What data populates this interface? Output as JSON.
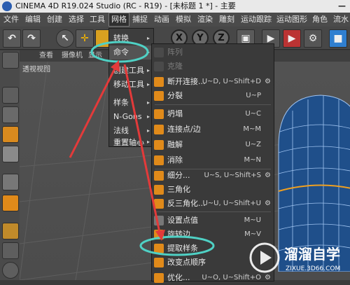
{
  "app": {
    "title": "CINEMA 4D R19.024 Studio (RC - R19) - [未标题 1 *] - 主要",
    "minimize": "—"
  },
  "menubar": [
    "文件",
    "编辑",
    "创建",
    "选择",
    "工具",
    "网格",
    "捕捉",
    "动画",
    "模拟",
    "渲染",
    "雕刻",
    "运动跟踪",
    "运动图形",
    "角色",
    "流水"
  ],
  "toolbar": {
    "axes": [
      "X",
      "Y",
      "Z"
    ]
  },
  "viewbar": [
    "查看",
    "摄像机",
    "显示"
  ],
  "viewport": {
    "label": "透视视图"
  },
  "submenu1": [
    {
      "label": "转换",
      "arrow": "▸"
    },
    {
      "label": "命令",
      "arrow": "▸"
    },
    {
      "label": "创建工具",
      "arrow": "▸"
    },
    {
      "label": "移动工具",
      "arrow": "▸"
    },
    {
      "label": "样条",
      "arrow": "▸"
    },
    {
      "label": "N-Gons",
      "arrow": "▸"
    },
    {
      "label": "法线",
      "arrow": "▸"
    },
    {
      "label": "重置轴心",
      "arrow": "▸"
    }
  ],
  "submenu2": [
    {
      "label": "阵列",
      "shortcut": "",
      "disabled": true,
      "gear": ""
    },
    {
      "label": "克隆",
      "shortcut": "",
      "disabled": true,
      "gear": ""
    },
    {
      "label": "断开连接...",
      "shortcut": "U~D, U~Shift+D",
      "disabled": false,
      "gear": "⚙"
    },
    {
      "label": "分裂",
      "shortcut": "U~P",
      "disabled": false,
      "gear": ""
    },
    {
      "label": "坍塌",
      "shortcut": "U~C",
      "disabled": false,
      "gear": ""
    },
    {
      "label": "连接点/边",
      "shortcut": "M~M",
      "disabled": false,
      "gear": ""
    },
    {
      "label": "融解",
      "shortcut": "U~Z",
      "disabled": false,
      "gear": ""
    },
    {
      "label": "消除",
      "shortcut": "M~N",
      "disabled": false,
      "gear": ""
    },
    {
      "label": "细分...",
      "shortcut": "U~S, U~Shift+S",
      "disabled": false,
      "gear": "⚙"
    },
    {
      "label": "三角化",
      "shortcut": "",
      "disabled": false,
      "gear": ""
    },
    {
      "label": "反三角化...",
      "shortcut": "U~U, U~Shift+U",
      "disabled": false,
      "gear": "⚙"
    },
    {
      "label": "设置点值",
      "shortcut": "M~U",
      "disabled": false,
      "gear": ""
    },
    {
      "label": "旋转边",
      "shortcut": "M~V",
      "disabled": false,
      "gear": ""
    },
    {
      "label": "提取样条",
      "shortcut": "",
      "disabled": false,
      "gear": ""
    },
    {
      "label": "改变点顺序",
      "shortcut": "",
      "disabled": false,
      "gear": ""
    },
    {
      "label": "优化...",
      "shortcut": "U~O, U~Shift+O",
      "disabled": false,
      "gear": "⚙"
    }
  ],
  "watermark": {
    "brand": "溜溜自学",
    "url": "ZIXUE.3D66.COM"
  },
  "colors": {
    "annotation_red": "#e33a3a",
    "annotation_teal": "#4fd1c5",
    "menu_bg": "#3a3a3a",
    "grid": "#5e5e5e"
  }
}
